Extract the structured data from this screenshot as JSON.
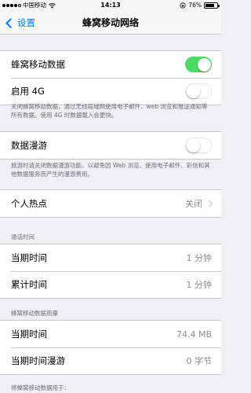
{
  "status_bar": {
    "carrier": "中国移动",
    "time": "14:13",
    "battery_percent": "76%",
    "battery_level": 0.76,
    "signal_bars_filled": 4,
    "signal_bars_total": 5
  },
  "nav": {
    "back_label": "设置",
    "title": "蜂窝移动网络"
  },
  "cellular_data": {
    "label": "蜂窝移动数据",
    "enabled": true
  },
  "enable_4g": {
    "label": "启用 4G",
    "enabled": false
  },
  "footnote_1": "关闭蜂窝移动数据，通过无线局域网使用电子邮件、web 浏览和推送通知等所有数据。使用 4G 时数据载入会更快。",
  "data_roaming": {
    "label": "数据漫游",
    "enabled": false
  },
  "footnote_2": "旅游时请关闭数据漫游功能，以避免因 Web 浏览、使用电子邮件、彩信和其他数据服务而产生的漫游费用。",
  "hotspot": {
    "label": "个人热点",
    "value": "关闭"
  },
  "call_time": {
    "header": "通话时间",
    "current_period_label": "当期时间",
    "current_period_value": "1 分钟",
    "lifetime_label": "累计时间",
    "lifetime_value": "1 分钟"
  },
  "data_usage": {
    "header": "蜂窝移动数据用量",
    "current_period_label": "当期时间",
    "current_period_value": "74.4 MB",
    "roaming_label": "当期时间漫游",
    "roaming_value": "0 字节"
  },
  "use_for_header": "将蜂窝移动数据用于：",
  "colors": {
    "accent": "#007aff",
    "toggle_on": "#4cd964",
    "background": "#efeff4"
  }
}
